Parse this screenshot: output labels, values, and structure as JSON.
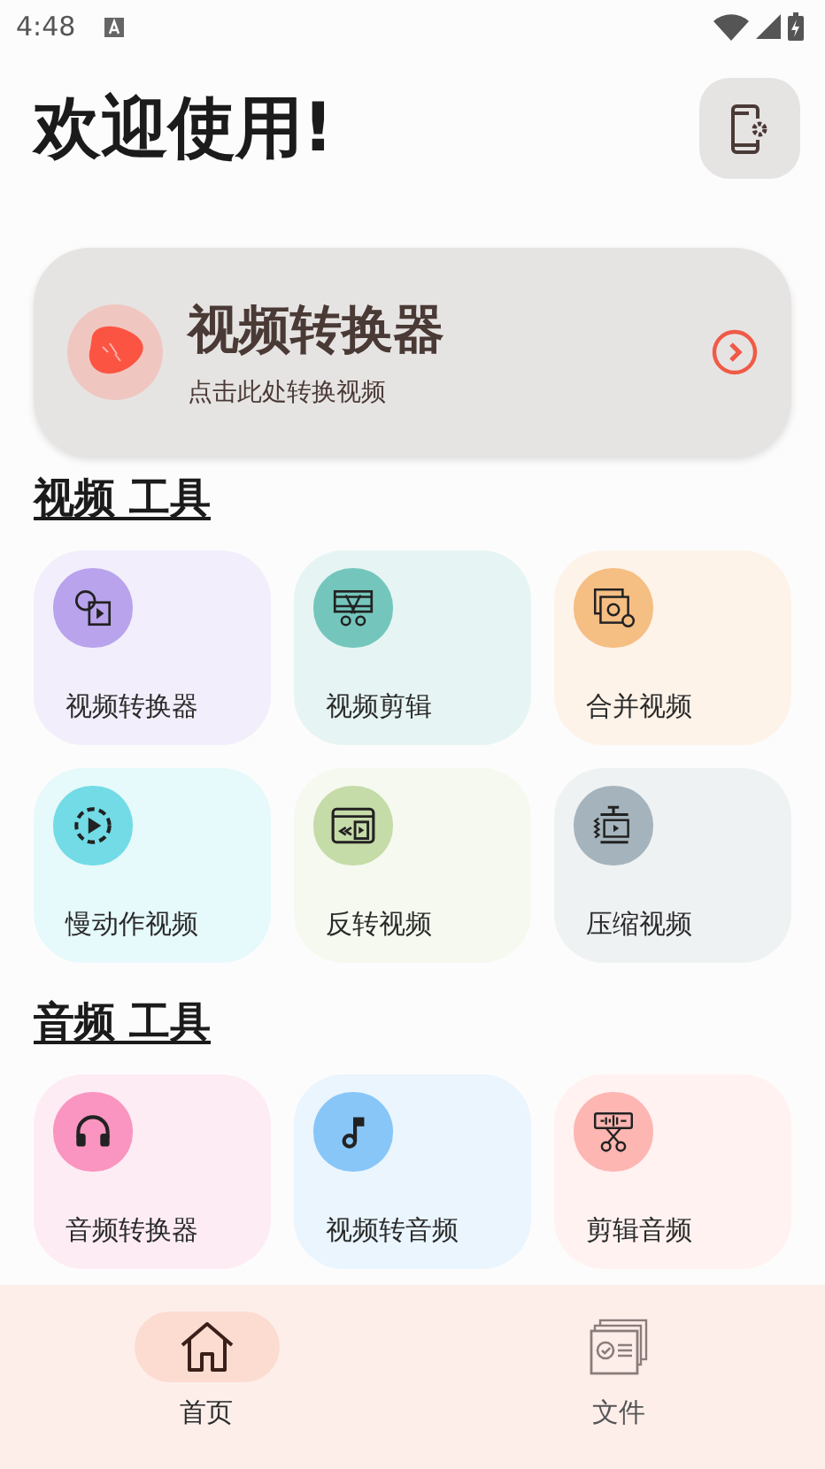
{
  "status_bar": {
    "time": "4:48"
  },
  "header": {
    "title": "欢迎使用!"
  },
  "hero": {
    "title": "视频转换器",
    "subtitle": "点击此处转换视频"
  },
  "sections": [
    {
      "title": "视频 工具",
      "tools": [
        {
          "label": "视频转换器",
          "kind": "converter",
          "color": "#b9a3ec"
        },
        {
          "label": "视频剪辑",
          "kind": "cut",
          "color": "#74c6bc"
        },
        {
          "label": "合并视频",
          "kind": "merge",
          "color": "#f5be83"
        },
        {
          "label": "慢动作视频",
          "kind": "slowmo",
          "color": "#72dbe6"
        },
        {
          "label": "反转视频",
          "kind": "reverse",
          "color": "#c5dba8"
        },
        {
          "label": "压缩视频",
          "kind": "compress",
          "color": "#a5b4bc"
        }
      ]
    },
    {
      "title": "音频 工具",
      "tools": [
        {
          "label": "音频转换器",
          "kind": "headphones",
          "color": "#f995c0"
        },
        {
          "label": "视频转音频",
          "kind": "music",
          "color": "#88c6f8"
        },
        {
          "label": "剪辑音频",
          "kind": "audio-cut",
          "color": "#fdb6b2"
        }
      ]
    }
  ],
  "nav": [
    {
      "label": "首页",
      "kind": "home",
      "selected": true
    },
    {
      "label": "文件",
      "kind": "files",
      "selected": false
    }
  ]
}
